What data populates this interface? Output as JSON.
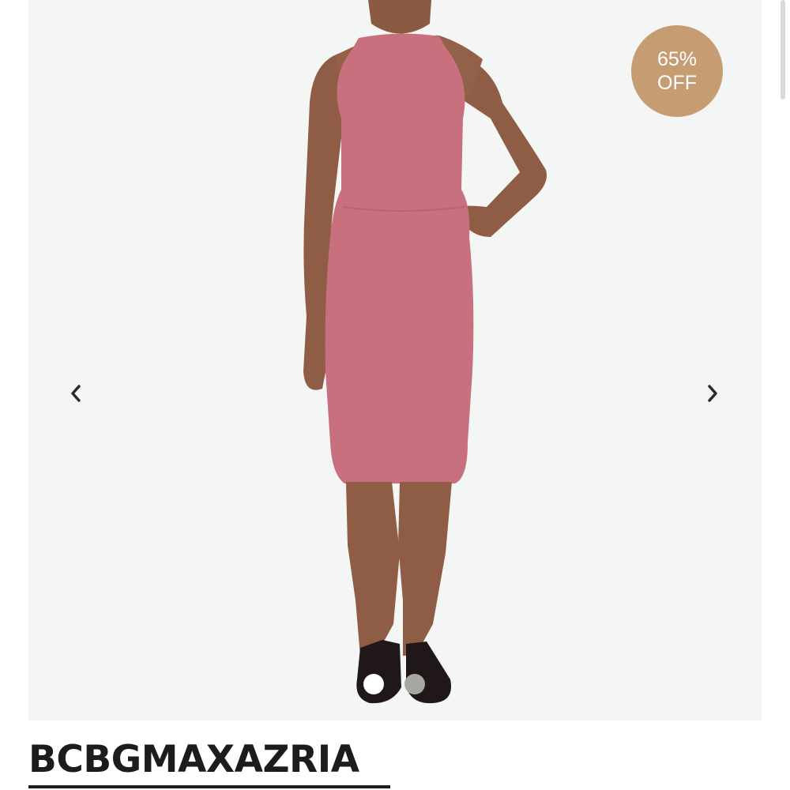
{
  "product": {
    "brand": "BCBGMAXAZRIA",
    "image_description_icon": "model-in-pink-halter-sheath-dress"
  },
  "badge": {
    "line1": "65%",
    "line2": "OFF",
    "color": "#c69c73"
  },
  "gallery": {
    "prev_icon": "chevron-left-icon",
    "next_icon": "chevron-right-icon",
    "image_count": 2,
    "active_index": 0
  },
  "colors": {
    "dress": "#c8707d",
    "background": "#f4f6f6",
    "brand_text": "#1c1c1c"
  }
}
